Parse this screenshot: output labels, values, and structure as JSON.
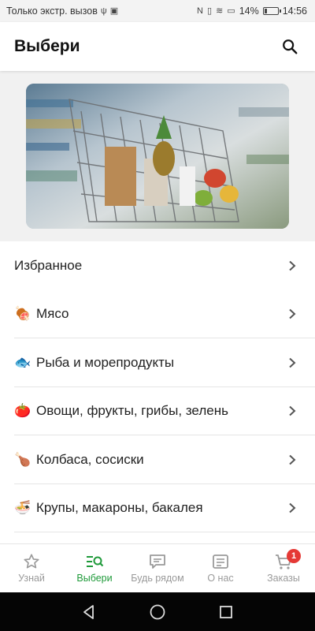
{
  "status_bar": {
    "carrier": "Только экстр. вызов",
    "battery": "14%",
    "time": "14:56"
  },
  "app_bar": {
    "title": "Выбери"
  },
  "list": [
    {
      "label": "Избранное",
      "emoji": ""
    },
    {
      "label": "Мясо",
      "emoji": "🍖"
    },
    {
      "label": "Рыба и морепродукты",
      "emoji": "🐟"
    },
    {
      "label": "Овощи, фрукты, грибы, зелень",
      "emoji": "🍅"
    },
    {
      "label": "Колбаса, сосиски",
      "emoji": "🍗"
    },
    {
      "label": "Крупы, макароны, бакалея",
      "emoji": "🍜"
    }
  ],
  "bottom_nav": [
    {
      "label": "Узнай",
      "icon": "star-icon"
    },
    {
      "label": "Выбери",
      "icon": "list-search-icon",
      "active": true
    },
    {
      "label": "Будь рядом",
      "icon": "chat-icon"
    },
    {
      "label": "О нас",
      "icon": "info-list-icon"
    },
    {
      "label": "Заказы",
      "icon": "cart-icon",
      "badge": "1"
    }
  ],
  "colors": {
    "accent": "#1f9a3a",
    "badge": "#e53935"
  }
}
